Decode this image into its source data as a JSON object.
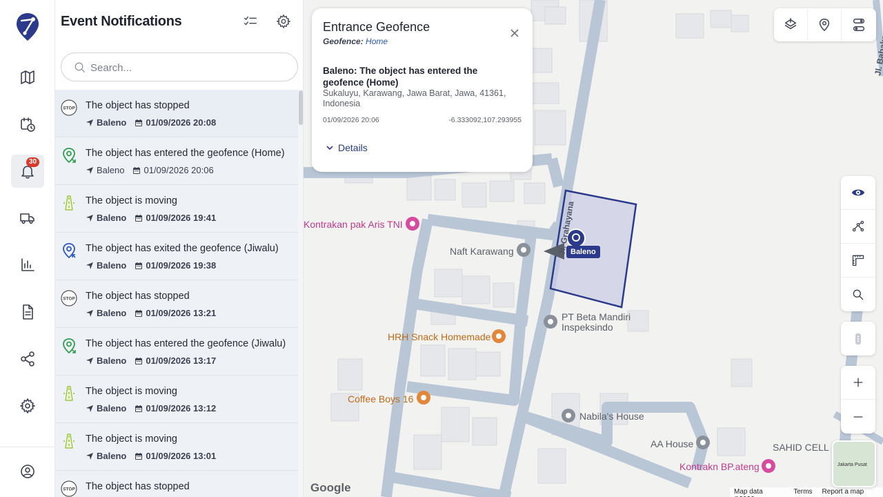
{
  "rail": {
    "notification_badge": "30"
  },
  "panel": {
    "title": "Event Notifications",
    "search_placeholder": "Search...",
    "events": [
      {
        "title": "The object has stopped",
        "vehicle": "Baleno",
        "datetime": "01/09/2026 20:08",
        "icon": "stop-icon",
        "bold": true
      },
      {
        "title": "The object has entered the geofence (Home)",
        "vehicle": "Baleno",
        "datetime": "01/09/2026 20:06",
        "icon": "geofence-enter-icon",
        "bold": false
      },
      {
        "title": "The object is moving",
        "vehicle": "Baleno",
        "datetime": "01/09/2026 19:41",
        "icon": "moving-icon",
        "bold": true
      },
      {
        "title": "The object has exited the geofence (Jiwalu)",
        "vehicle": "Baleno",
        "datetime": "01/09/2026 19:38",
        "icon": "geofence-exit-icon",
        "bold": true
      },
      {
        "title": "The object has stopped",
        "vehicle": "Baleno",
        "datetime": "01/09/2026 13:21",
        "icon": "stop-icon",
        "bold": true
      },
      {
        "title": "The object has entered the geofence (Jiwalu)",
        "vehicle": "Baleno",
        "datetime": "01/09/2026 13:17",
        "icon": "geofence-enter-icon",
        "bold": true
      },
      {
        "title": "The object is moving",
        "vehicle": "Baleno",
        "datetime": "01/09/2026 13:12",
        "icon": "moving-icon",
        "bold": true
      },
      {
        "title": "The object is moving",
        "vehicle": "Baleno",
        "datetime": "01/09/2026 13:01",
        "icon": "moving-icon",
        "bold": true
      },
      {
        "title": "The object has stopped",
        "vehicle": "",
        "datetime": "",
        "icon": "stop-icon",
        "bold": true
      }
    ]
  },
  "popup": {
    "title": "Entrance Geofence",
    "geofence_label": "Geofence:",
    "geofence_name": "Home",
    "message": "Baleno: The object has entered the geofence (Home)",
    "address": "Sukaluyu, Karawang, Jawa Barat, Jawa, 41361, Indonesia",
    "datetime": "01/09/2026 20:06",
    "coordinates": "-6.333092,107.293955",
    "details_label": "Details"
  },
  "map": {
    "vehicle_label": "Baleno",
    "street_label": "Jl. Grahayana",
    "street_label_2": "Jl. Babakan",
    "pois": {
      "kontrakan": "Kontrakan pak Aris TNI",
      "naft": "Naft Karawang",
      "beta_line1": "PT Beta Mandiri",
      "beta_line2": "Inspeksindo",
      "hrh": "HRH Snack Homemade",
      "coffee": "Coffee Boys 16",
      "nabila": "Nabila's House",
      "aa": "AA House",
      "sahid": "SAHID CELL",
      "kontrakn": "Kontrakn BP.ateng"
    },
    "google": "Google",
    "attribution": {
      "data": "Map data ©2026",
      "terms": "Terms",
      "report": "Report a map error"
    },
    "minimap_label": "Jakarta Pusat"
  },
  "colors": {
    "accent": "#2b3a8a",
    "badge": "#d93a2b",
    "geofence_fill": "#c9cce4",
    "road": "#b9c6d6",
    "stop_icon": "#555555",
    "geofence_icon": "#2e9e4e",
    "moving_icon": "#8fbf2a"
  }
}
